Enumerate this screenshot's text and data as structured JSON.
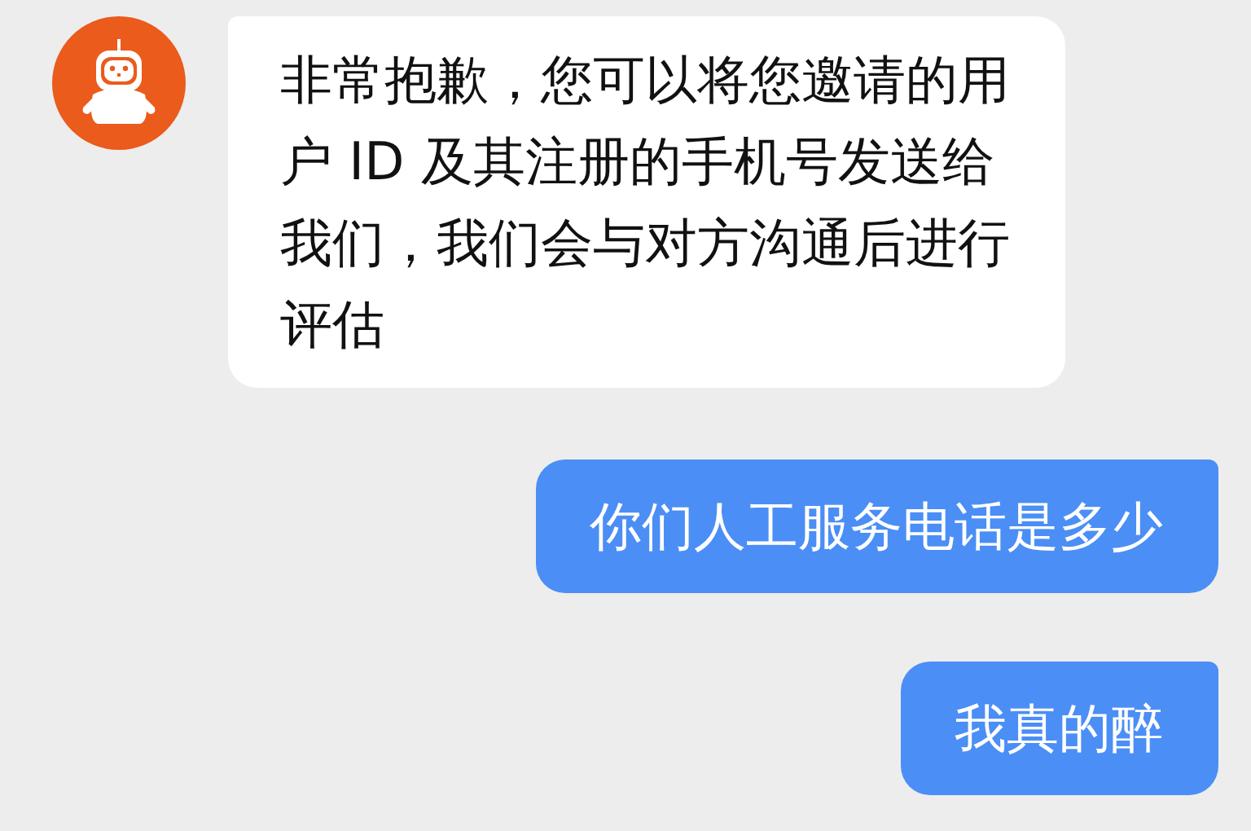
{
  "messages": [
    {
      "kind": "incoming",
      "text": "非常抱歉，您可以将您邀请的用户 ID 及其注册的手机号发送给我们，我们会与对方沟通后进行评估"
    },
    {
      "kind": "outgoing",
      "text": "你们人工服务电话是多少"
    },
    {
      "kind": "outgoing",
      "text": "我真的醉"
    }
  ]
}
